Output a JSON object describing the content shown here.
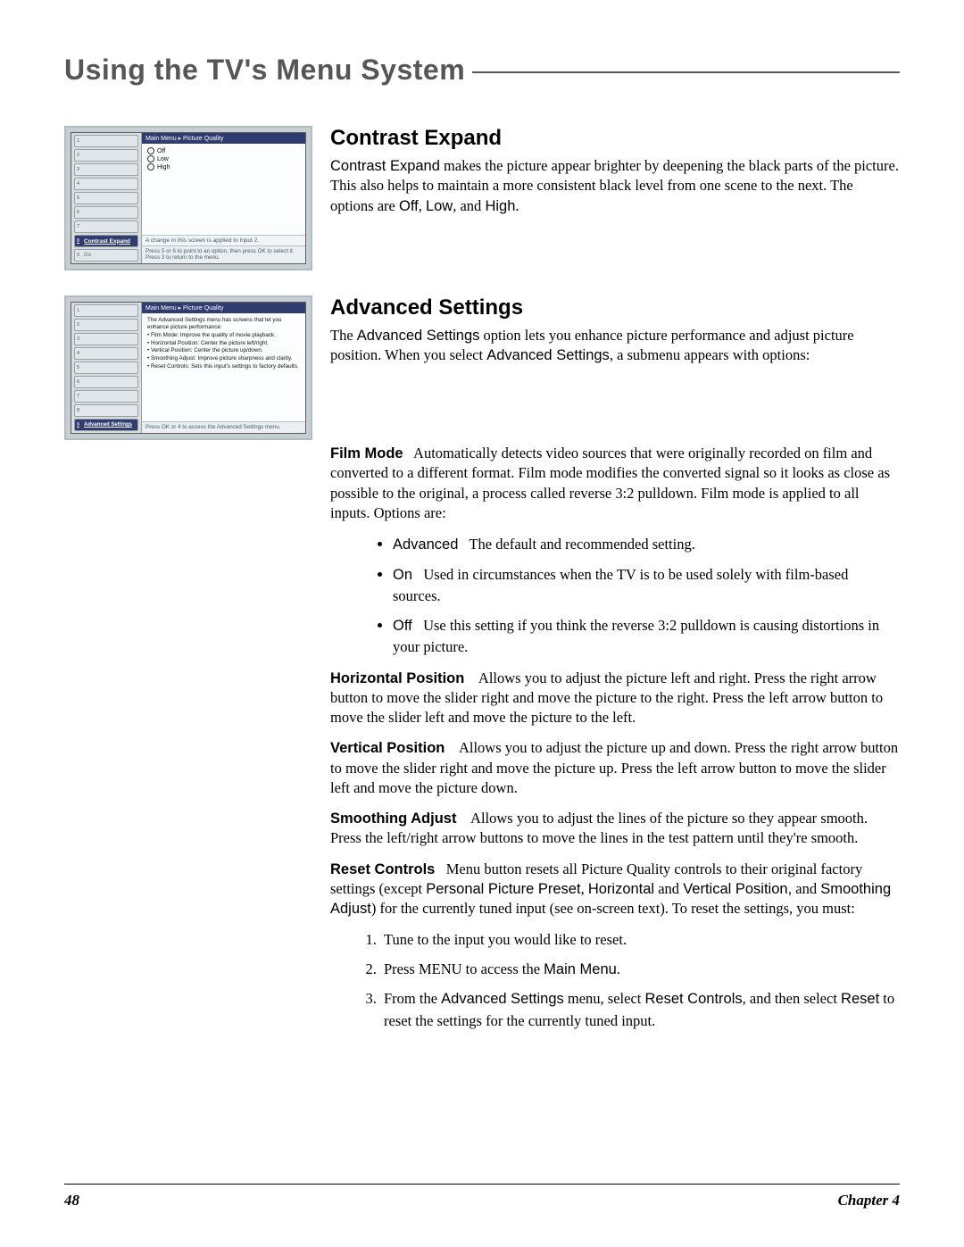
{
  "page_title": "Using the TV's Menu System",
  "sections": {
    "contrast": {
      "heading": "Contrast Expand",
      "body_html": "<span class='sf'>Contrast Expand</span> makes the picture appear brighter by deepening the black parts of the picture. This also helps to maintain a more consistent black level from one scene to the next. The options are <span class='sf'>Off</span>, <span class='sf'>Low</span>, and <span class='sf'>High</span>."
    },
    "advanced": {
      "heading": "Advanced Settings",
      "intro_html": "The <span class='sf'>Advanced Settings</span> option lets you enhance picture performance and adjust picture position. When you select <span class='sf'>Advanced Settings</span>, a submenu appears with options:",
      "film_mode_html": "<span class='sf bold'>Film Mode</span> &nbsp; Automatically detects video sources that were originally recorded on film and converted to a different format. Film mode modifies the converted signal so it looks as close as possible to the original, a process called reverse 3:2 pulldown. Film mode is applied to all inputs. Options are:",
      "film_bullets": [
        "<span class='sf'>Advanced</span> &nbsp; The default and recommended setting.",
        "<span class='sf'>On</span> &nbsp; Used in circumstances when the TV is to be used solely with film-based sources.",
        "<span class='sf'>Off</span> &nbsp; Use this setting if you think the reverse 3:2 pulldown is causing distortions in your picture."
      ],
      "hpos_html": "<span class='sf bold'>Horizontal Position</span> &nbsp;&nbsp; Allows you to adjust the picture left and right. Press the right arrow button to move the slider right and move the picture to the right. Press the left arrow button to move the slider left and move the picture to the left.",
      "vpos_html": "<span class='sf bold'>Vertical Position</span> &nbsp;&nbsp; Allows you to adjust the picture up and down. Press the right arrow button to move the slider right and move the picture up. Press the left arrow button to move the slider left and move the picture down.",
      "smooth_html": "<span class='sf bold'>Smoothing Adjust</span> &nbsp;&nbsp; Allows you to adjust the lines of the picture so they appear smooth. Press the left/right arrow buttons to move the lines in the test pattern until they're smooth.",
      "reset_html": "<span class='sf bold'>Reset Controls</span> &nbsp;&nbsp;Menu button resets all Picture Quality controls to their original factory settings (except <span class='sf'>Personal Picture Preset</span>, <span class='sf'>Horizontal</span> and <span class='sf'>Vertical Position,</span> and <span class='sf'>Smoothing Adjust</span>) for the currently tuned input (see on-screen text). To reset the settings, you must:",
      "steps": [
        "Tune to the input you would like to reset.",
        "Press MENU to access the <span class='sf'>Main Menu</span>.",
        "From the <span class='sf'>Advanced Settings</span> menu, select <span class='sf'>Reset Controls</span>, and then select <span class='sf'>Reset</span> to reset the settings for the currently tuned input."
      ]
    }
  },
  "tv1": {
    "crumb": "Main Menu ▸ Picture Quality",
    "options": [
      "Off",
      "Low",
      "High"
    ],
    "side_selected_index": 7,
    "side_selected_label": "Contrast Expand",
    "status": "A change in this screen is applied to Input 2.",
    "hint": "Press 5  or 6  to point to an option, then press OK to select it. Press 3 to return to the menu."
  },
  "tv2": {
    "crumb": "Main Menu ▸ Picture Quality",
    "desc_intro": "The Advanced Settings menu has screens that let you enhance picture performance:",
    "desc_lines": [
      "• Film Mode: Improve the quality of movie playback.",
      "• Horizontal Position: Center the picture left/right.",
      "• Vertical Position: Center the picture up/down.",
      "• Smoothing Adjust: Improve picture sharpness and clarity.",
      "• Reset Controls: Sets this input's settings to factory defaults."
    ],
    "side_selected_index": 8,
    "side_selected_label": "Advanced Settings",
    "hint": "Press OK or 4  to access the Advanced Settings menu."
  },
  "footer": {
    "page_no": "48",
    "chapter": "Chapter 4"
  }
}
